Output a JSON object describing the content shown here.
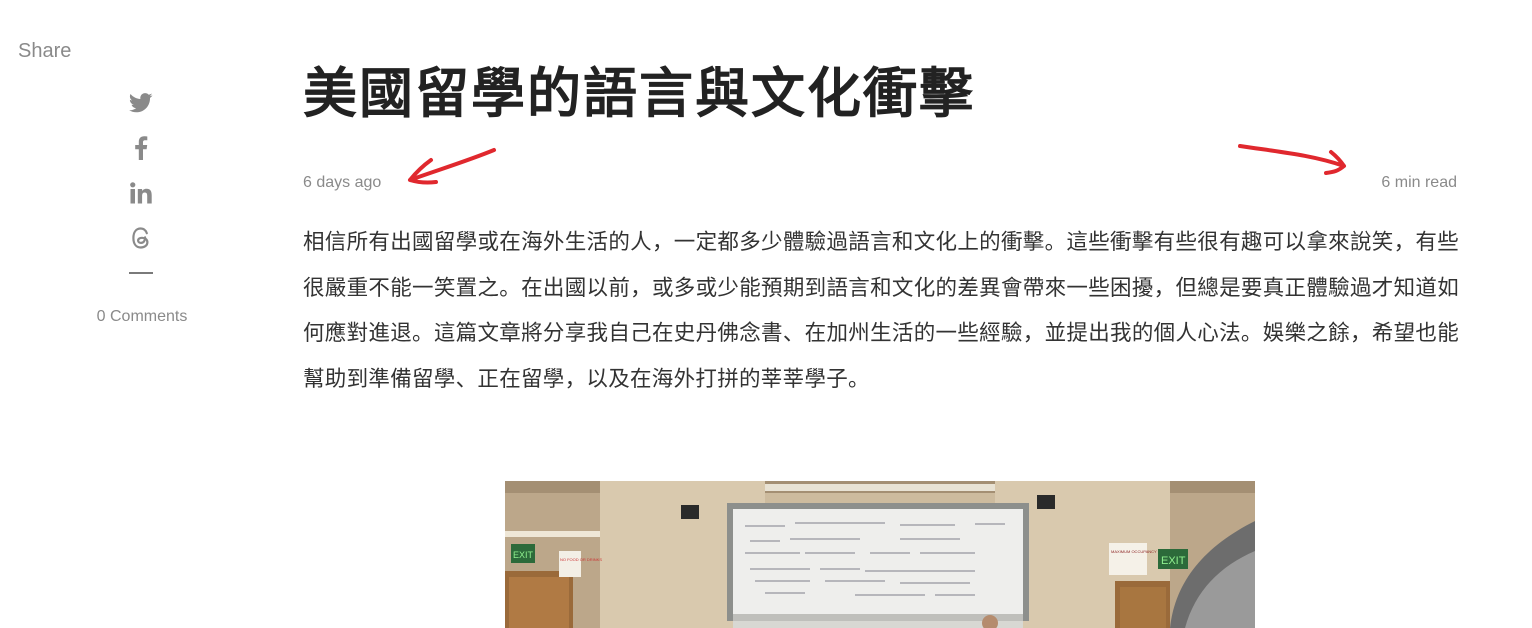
{
  "share": {
    "label": "Share",
    "icons": [
      "twitter-icon",
      "facebook-icon",
      "linkedin-icon",
      "threads-icon"
    ],
    "comments": "0 Comments"
  },
  "article": {
    "title": "美國留學的語言與文化衝擊",
    "date": "6 days ago",
    "read_time": "6 min read",
    "body": "相信所有出國留學或在海外生活的人，一定都多少體驗過語言和文化上的衝擊。這些衝擊有些很有趣可以拿來說笑，有些很嚴重不能一笑置之。在出國以前，或多或少能預期到語言和文化的差異會帶來一些困擾，但總是要真正體驗過才知道如何應對進退。這篇文章將分享我自己在史丹佛念書、在加州生活的一些經驗，並提出我的個人心法。娛樂之餘，希望也能幫助到準備留學、正在留學，以及在海外打拼的莘莘學子。"
  },
  "photo": {
    "exit_sign_text": "EXIT",
    "no_food_text": "NO FOOD OR DRINKS",
    "occupancy_text": "MAXIMUM OCCUPANCY CAPACITY"
  },
  "colors": {
    "title": "#222222",
    "muted": "#8a8a8a",
    "annotation": "#e0282e"
  }
}
